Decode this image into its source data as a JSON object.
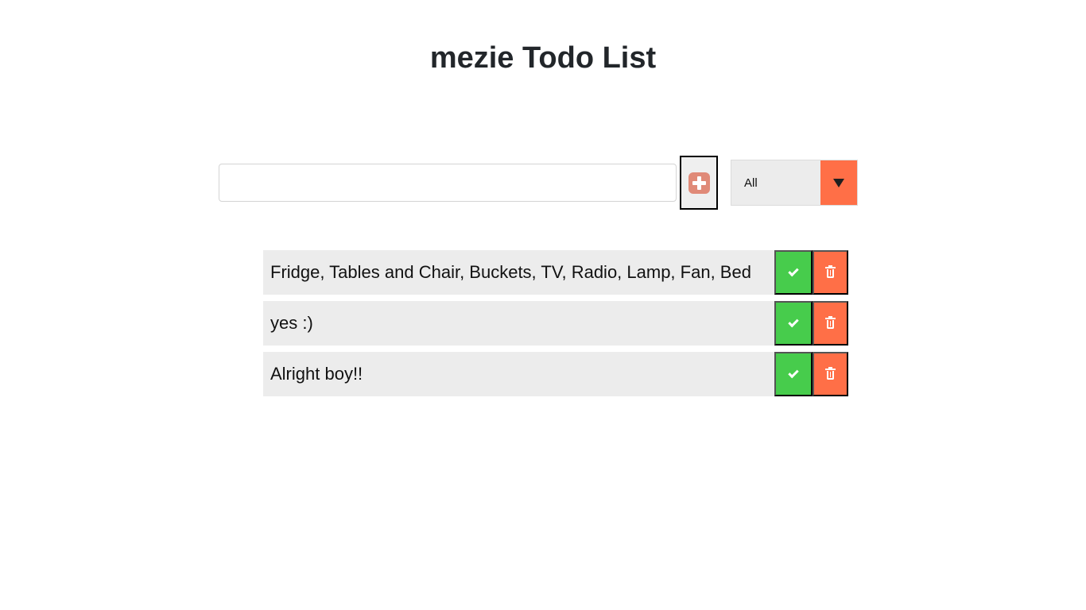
{
  "app": {
    "title": "mezie Todo List"
  },
  "form": {
    "input_value": "",
    "input_placeholder": "",
    "add_icon": "plus-square-icon",
    "filter": {
      "selected": "All"
    }
  },
  "todos": [
    {
      "text": "Fridge, Tables and Chair, Buckets, TV, Radio, Lamp, Fan, Bed"
    },
    {
      "text": "yes :)"
    },
    {
      "text": "Alright boy!!"
    }
  ],
  "colors": {
    "complete": "#47cc4c",
    "delete": "#ff6f47",
    "add_icon": "#e08a78",
    "item_background": "#ececec"
  }
}
